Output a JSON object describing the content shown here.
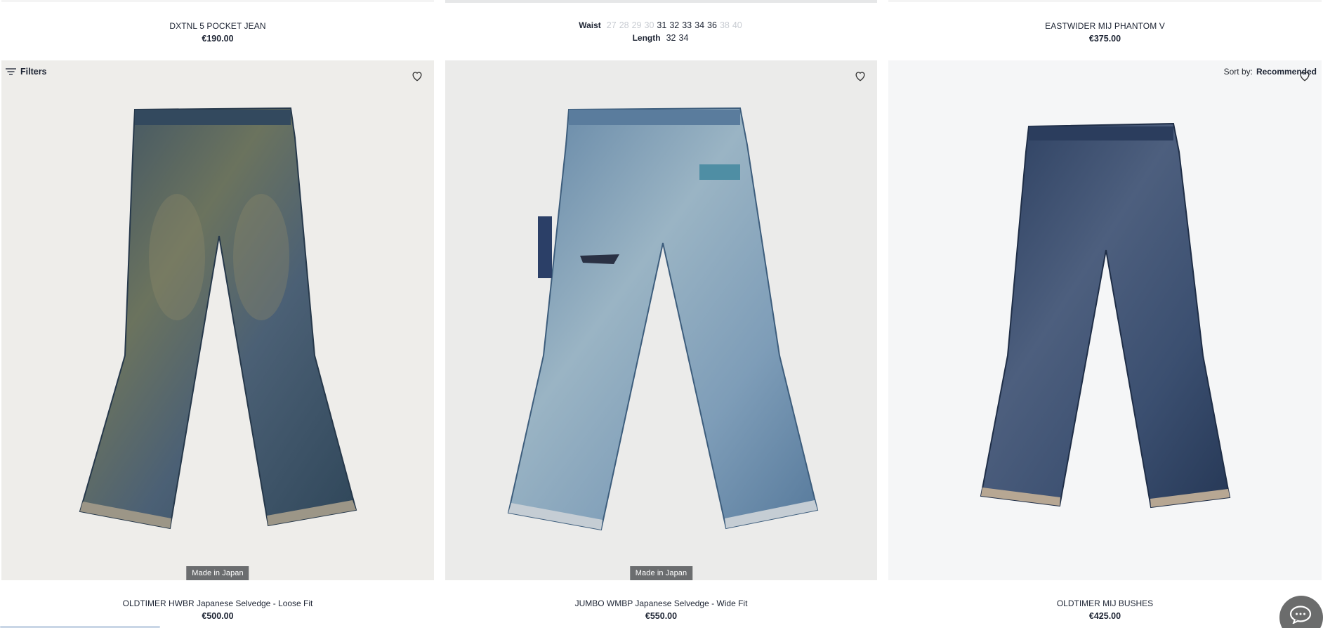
{
  "top_row": {
    "left": {
      "title": "DXTNL 5 POCKET JEAN",
      "price": "€190.00"
    },
    "middle": {
      "waist_label": "Waist",
      "waist_sizes": [
        {
          "size": "27",
          "available": false
        },
        {
          "size": "28",
          "available": false
        },
        {
          "size": "29",
          "available": false
        },
        {
          "size": "30",
          "available": false
        },
        {
          "size": "31",
          "available": true
        },
        {
          "size": "32",
          "available": true
        },
        {
          "size": "33",
          "available": true
        },
        {
          "size": "34",
          "available": true
        },
        {
          "size": "36",
          "available": true
        },
        {
          "size": "38",
          "available": false
        },
        {
          "size": "40",
          "available": false
        }
      ],
      "length_label": "Length",
      "length_sizes": [
        {
          "size": "32",
          "available": true
        },
        {
          "size": "34",
          "available": true
        }
      ]
    },
    "right": {
      "title": "EASTWIDER MIJ PHANTOM V",
      "price": "€375.00"
    }
  },
  "toolbar": {
    "filters_label": "Filters",
    "sort_label": "Sort by:",
    "sort_value": "Recommended"
  },
  "products": [
    {
      "title": "OLDTIMER HWBR Japanese Selvedge - Loose Fit",
      "price": "€500.00",
      "badge": "Made in Japan",
      "image_icon": "jeans-image",
      "wash_color": "#3e566b"
    },
    {
      "title": "JUMBO WMBP Japanese Selvedge - Wide Fit",
      "price": "€550.00",
      "badge": "Made in Japan",
      "image_icon": "jeans-image",
      "wash_color": "#6f8fac"
    },
    {
      "title": "OLDTIMER MIJ BUSHES",
      "price": "€425.00",
      "badge": "",
      "image_icon": "jeans-image",
      "wash_color": "#33486a"
    }
  ],
  "icons": {
    "wishlist": "heart-outline-icon",
    "filters": "filter-lines-icon",
    "chat": "chat-bubble-icon"
  },
  "colors": {
    "text": "#1d2433",
    "badge_bg": "#6b6d6f",
    "chat_bg": "#6b6c6c",
    "unavailable_size": "#c8ccd2"
  }
}
